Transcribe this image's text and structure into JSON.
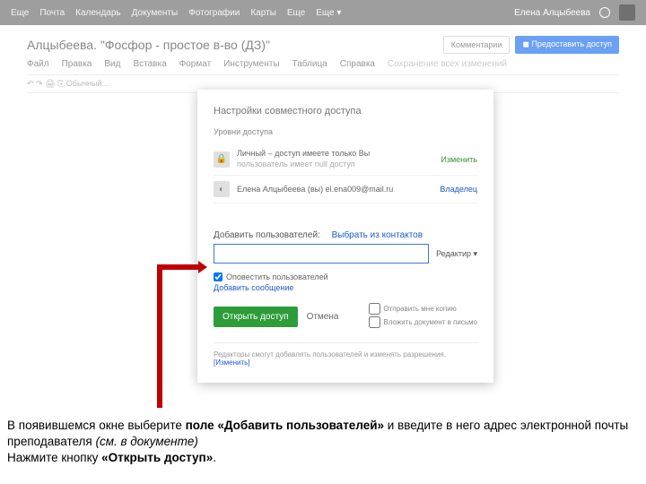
{
  "topnav": {
    "items": [
      "Еще",
      "Почта",
      "Календарь",
      "Документы",
      "Фотографии",
      "Карты",
      "Еще",
      "Еще ▾"
    ],
    "right": "Елена Алцыбеева"
  },
  "doc": {
    "title": "Алцыбеева. \"Фосфор - простое в-во (ДЗ)\"",
    "menu": [
      "Файл",
      "Правка",
      "Вид",
      "Вставка",
      "Формат",
      "Инструменты",
      "Таблица",
      "Справка",
      "Сохранение всех изменений"
    ],
    "comments": "Комментарии",
    "share": "◼ Предоставить доступ",
    "toolbar": "↶  ↷  🖨  ⎘   Обычный..."
  },
  "modal": {
    "title": "Настройки совместного доступа",
    "sub": "Уровни доступа",
    "users": [
      {
        "icon": "🔒",
        "name": "Личный – доступ имеете только Вы",
        "sub": "пользователь имеет null доступ",
        "role": "Изменить",
        "cls": "edit"
      },
      {
        "icon": "◐",
        "name": "Елена Алцыбеева (вы) el.ena009@mail.ru",
        "sub": "",
        "role": "Владелец",
        "cls": "own"
      }
    ],
    "add_label": "Добавить пользователей:",
    "contacts_link": "Выбрать из контактов",
    "perm": "Редактир ▾",
    "notify": "Оповестить пользователей",
    "msg": "Добавить сообщение",
    "open": "Открыть доступ",
    "cancel": "Отмена",
    "rc1": "Отправить мне копию",
    "rc2": "Вложить документ в письмо",
    "foot_text": "Редакторы смогут добавлять пользователей и изменять разрешения.",
    "foot_link": "[Изменить]"
  },
  "caption": {
    "l1a": "В появившемся окне выберите ",
    "l1b": "поле «Добавить пользователей»",
    "l1c": " и введите в него адрес электронной почты преподавателя ",
    "l1d": "(см. в документе)",
    "l2a": "Нажмите кнопку ",
    "l2b": "«Открыть доступ»",
    "l2c": "."
  }
}
